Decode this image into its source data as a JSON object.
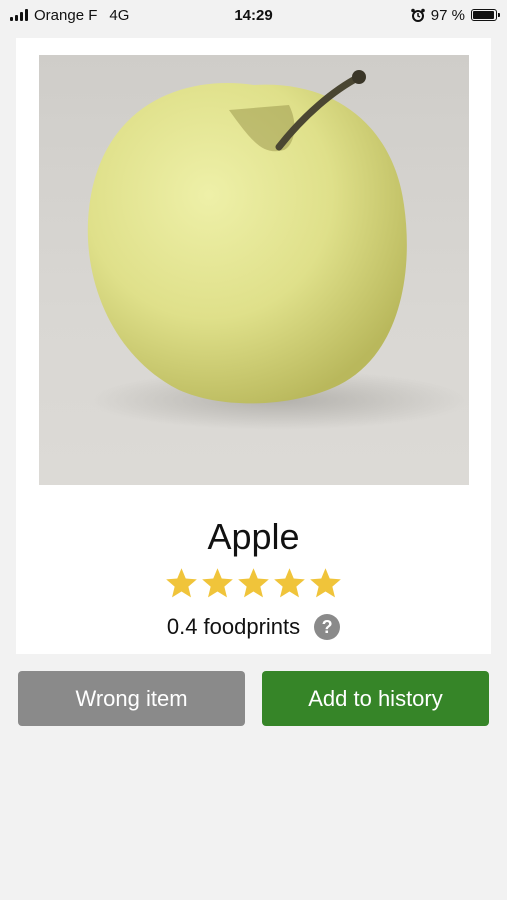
{
  "status_bar": {
    "carrier": "Orange F",
    "network": "4G",
    "time": "14:29",
    "battery_percent": "97 %",
    "battery_level": 0.97
  },
  "item": {
    "name": "Apple",
    "rating": 5,
    "rating_max": 5,
    "footprint_text": "0.4 foodprints",
    "photo_alt": "photo",
    "help_glyph": "?"
  },
  "actions": {
    "wrong_label": "Wrong item",
    "add_label": "Add to history"
  },
  "colors": {
    "star": "#f0c43a",
    "add_button": "#368528",
    "wrong_button": "#8a8a8a",
    "background": "#f2f2f2"
  }
}
